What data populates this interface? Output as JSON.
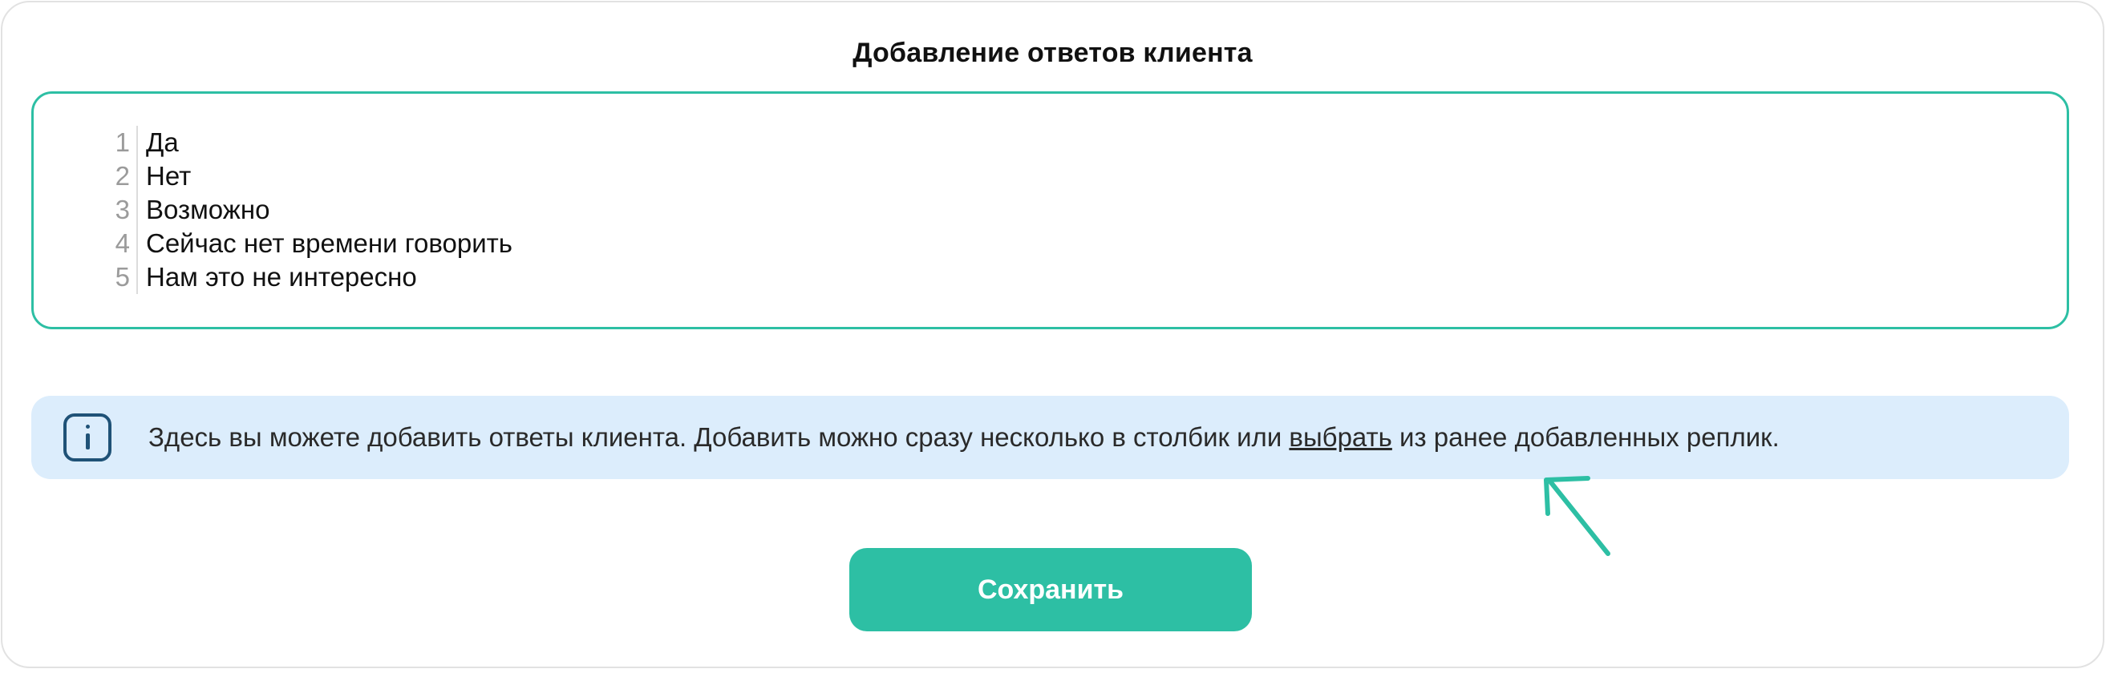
{
  "dialog": {
    "title": "Добавление ответов клиента"
  },
  "editor": {
    "lines": [
      {
        "num": "1",
        "text": "Да"
      },
      {
        "num": "2",
        "text": "Нет"
      },
      {
        "num": "3",
        "text": "Возможно"
      },
      {
        "num": "4",
        "text": "Сейчас нет времени говорить"
      },
      {
        "num": "5",
        "text": "Нам это не интересно"
      }
    ]
  },
  "info": {
    "icon": "info-icon",
    "text_before": "Здесь вы можете добавить ответы клиента. Добавить можно сразу несколько в столбик или ",
    "link": "выбрать",
    "text_after": " из ранее добавленных реплик."
  },
  "actions": {
    "save_label": "Сохранить"
  },
  "colors": {
    "accent": "#2dbfa4",
    "info_background": "#dcedfc",
    "info_icon": "#1f5277",
    "border": "#e2e2e2"
  }
}
